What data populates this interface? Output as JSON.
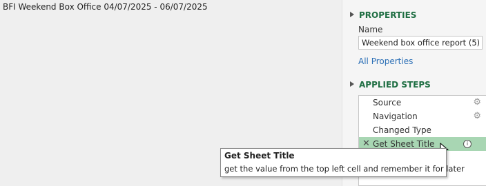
{
  "preview": {
    "cell_text": "BFI Weekend Box Office 04/07/2025 - 06/07/2025"
  },
  "properties": {
    "header": "PROPERTIES",
    "name_label": "Name",
    "name_value": "Weekend box office report (5)",
    "all_properties_link": "All Properties"
  },
  "applied_steps": {
    "header": "APPLIED STEPS",
    "steps": [
      {
        "label": "Source",
        "has_gear": true
      },
      {
        "label": "Navigation",
        "has_gear": true
      },
      {
        "label": "Changed Type",
        "has_gear": false
      },
      {
        "label": "Get Sheet Title",
        "selected": true,
        "has_info": true
      }
    ],
    "info_icon_glyph": "i",
    "delete_glyph": "✕"
  },
  "tooltip": {
    "title": "Get Sheet Title",
    "description": "get the value from the top left cell and remember it for later"
  },
  "colors": {
    "section_header": "#1e6e42",
    "link": "#2b6fb6",
    "selected_step": "#a8d6b3"
  }
}
